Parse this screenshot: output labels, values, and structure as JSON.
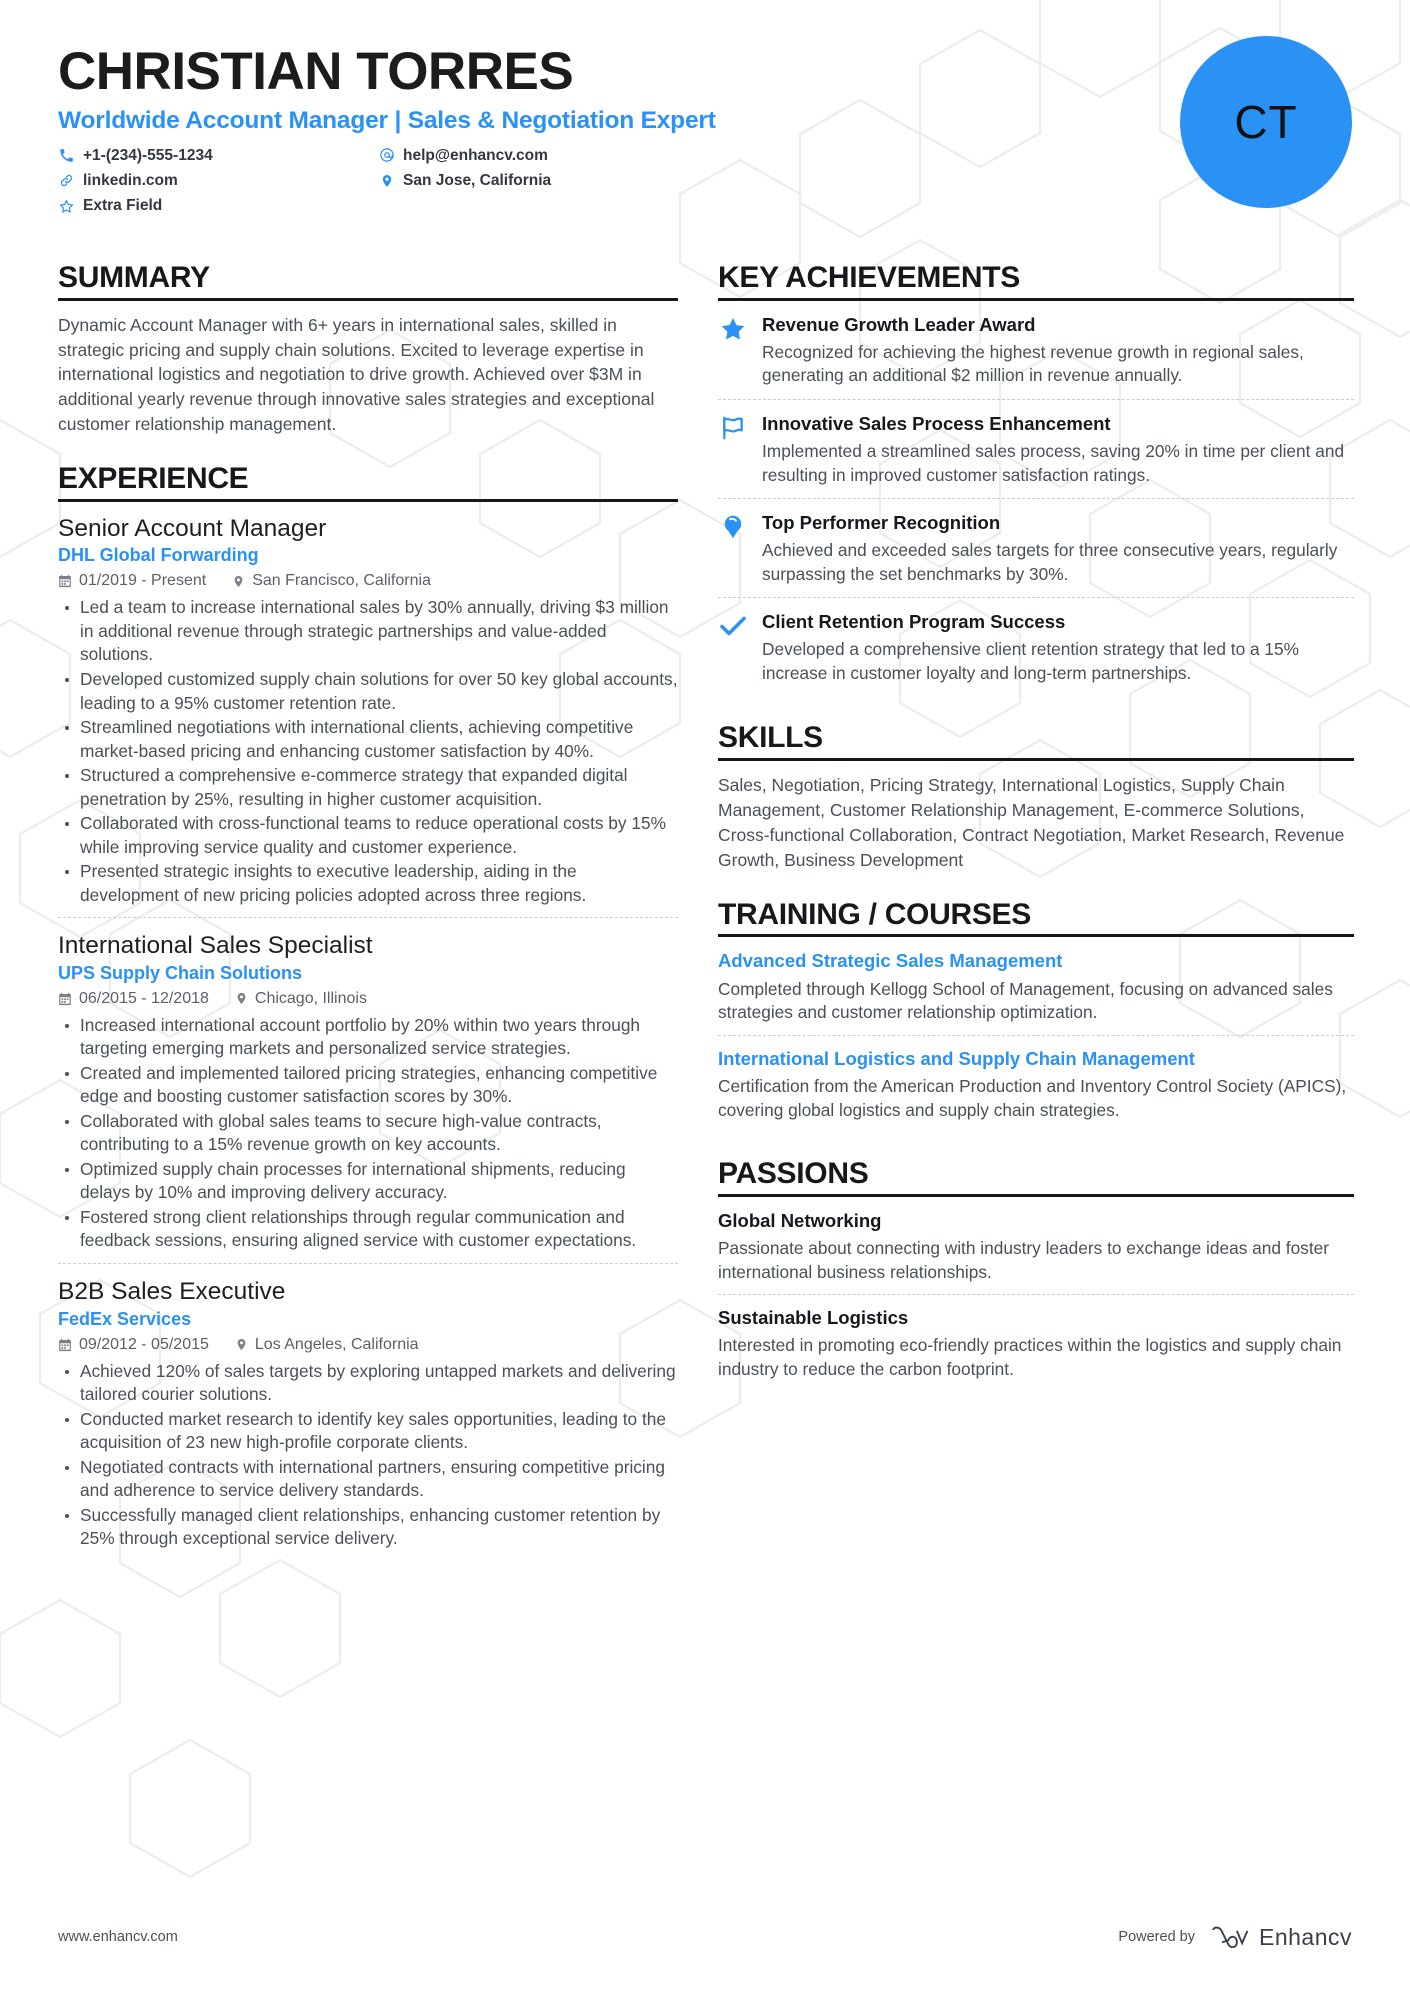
{
  "header": {
    "name": "CHRISTIAN TORRES",
    "headline": "Worldwide Account Manager | Sales & Negotiation Expert",
    "avatar_initials": "CT",
    "accent_color": "#2a91f5",
    "contacts": [
      {
        "icon": "phone-icon",
        "text": "+1-(234)-555-1234"
      },
      {
        "icon": "email-icon",
        "text": "help@enhancv.com"
      },
      {
        "icon": "link-icon",
        "text": "linkedin.com"
      },
      {
        "icon": "location-icon",
        "text": "San Jose, California"
      },
      {
        "icon": "star-outline-icon",
        "text": "Extra Field"
      }
    ]
  },
  "summary": {
    "title": "SUMMARY",
    "text": "Dynamic Account Manager with 6+ years in international sales, skilled in strategic pricing and supply chain solutions. Excited to leverage expertise in international logistics and negotiation to drive growth. Achieved over $3M in additional yearly revenue through innovative sales strategies and exceptional customer relationship management."
  },
  "experience": {
    "title": "EXPERIENCE",
    "jobs": [
      {
        "role": "Senior Account Manager",
        "company": "DHL Global Forwarding",
        "dates": "01/2019 - Present",
        "location": "San Francisco, California",
        "bullets": [
          "Led a team to increase international sales by 30% annually, driving $3 million in additional revenue through strategic partnerships and value-added solutions.",
          "Developed customized supply chain solutions for over 50 key global accounts, leading to a 95% customer retention rate.",
          "Streamlined negotiations with international clients, achieving competitive market-based pricing and enhancing customer satisfaction by 40%.",
          "Structured a comprehensive e-commerce strategy that expanded digital penetration by 25%, resulting in higher customer acquisition.",
          "Collaborated with cross-functional teams to reduce operational costs by 15% while improving service quality and customer experience.",
          "Presented strategic insights to executive leadership, aiding in the development of new pricing policies adopted across three regions."
        ]
      },
      {
        "role": "International Sales Specialist",
        "company": "UPS Supply Chain Solutions",
        "dates": "06/2015 - 12/2018",
        "location": "Chicago, Illinois",
        "bullets": [
          "Increased international account portfolio by 20% within two years through targeting emerging markets and personalized service strategies.",
          "Created and implemented tailored pricing strategies, enhancing competitive edge and boosting customer satisfaction scores by 30%.",
          "Collaborated with global sales teams to secure high-value contracts, contributing to a 15% revenue growth on key accounts.",
          "Optimized supply chain processes for international shipments, reducing delays by 10% and improving delivery accuracy.",
          "Fostered strong client relationships through regular communication and feedback sessions, ensuring aligned service with customer expectations."
        ]
      },
      {
        "role": "B2B Sales Executive",
        "company": "FedEx Services",
        "dates": "09/2012 - 05/2015",
        "location": "Los Angeles, California",
        "bullets": [
          "Achieved 120% of sales targets by exploring untapped markets and delivering tailored courier solutions.",
          "Conducted market research to identify key sales opportunities, leading to the acquisition of 23 new high-profile corporate clients.",
          "Negotiated contracts with international partners, ensuring competitive pricing and adherence to service delivery standards.",
          "Successfully managed client relationships, enhancing customer retention by 25% through exceptional service delivery."
        ]
      }
    ]
  },
  "key_achievements": {
    "title": "KEY ACHIEVEMENTS",
    "items": [
      {
        "icon": "star-icon",
        "title": "Revenue Growth Leader Award",
        "desc": "Recognized for achieving the highest revenue growth in regional sales, generating an additional $2 million in revenue annually."
      },
      {
        "icon": "flag-icon",
        "title": "Innovative Sales Process Enhancement",
        "desc": "Implemented a streamlined sales process, saving 20% in time per client and resulting in improved customer satisfaction ratings."
      },
      {
        "icon": "badge-icon",
        "title": "Top Performer Recognition",
        "desc": "Achieved and exceeded sales targets for three consecutive years, regularly surpassing the set benchmarks by 30%."
      },
      {
        "icon": "check-icon",
        "title": "Client Retention Program Success",
        "desc": "Developed a comprehensive client retention strategy that led to a 15% increase in customer loyalty and long-term partnerships."
      }
    ]
  },
  "skills": {
    "title": "SKILLS",
    "text": "Sales, Negotiation, Pricing Strategy, International Logistics, Supply Chain Management, Customer Relationship Management, E-commerce Solutions, Cross-functional Collaboration, Contract Negotiation, Market Research, Revenue Growth, Business Development"
  },
  "training": {
    "title": "TRAINING / COURSES",
    "items": [
      {
        "title": "Advanced Strategic Sales Management",
        "desc": "Completed through Kellogg School of Management, focusing on advanced sales strategies and customer relationship optimization."
      },
      {
        "title": "International Logistics and Supply Chain Management",
        "desc": "Certification from the American Production and Inventory Control Society (APICS), covering global logistics and supply chain strategies."
      }
    ]
  },
  "passions": {
    "title": "PASSIONS",
    "items": [
      {
        "title": "Global Networking",
        "desc": "Passionate about connecting with industry leaders to exchange ideas and foster international business relationships."
      },
      {
        "title": "Sustainable Logistics",
        "desc": "Interested in promoting eco-friendly practices within the logistics and supply chain industry to reduce the carbon footprint."
      }
    ]
  },
  "footer": {
    "website": "www.enhancv.com",
    "powered_by": "Powered by",
    "brand": "Enhancv"
  }
}
